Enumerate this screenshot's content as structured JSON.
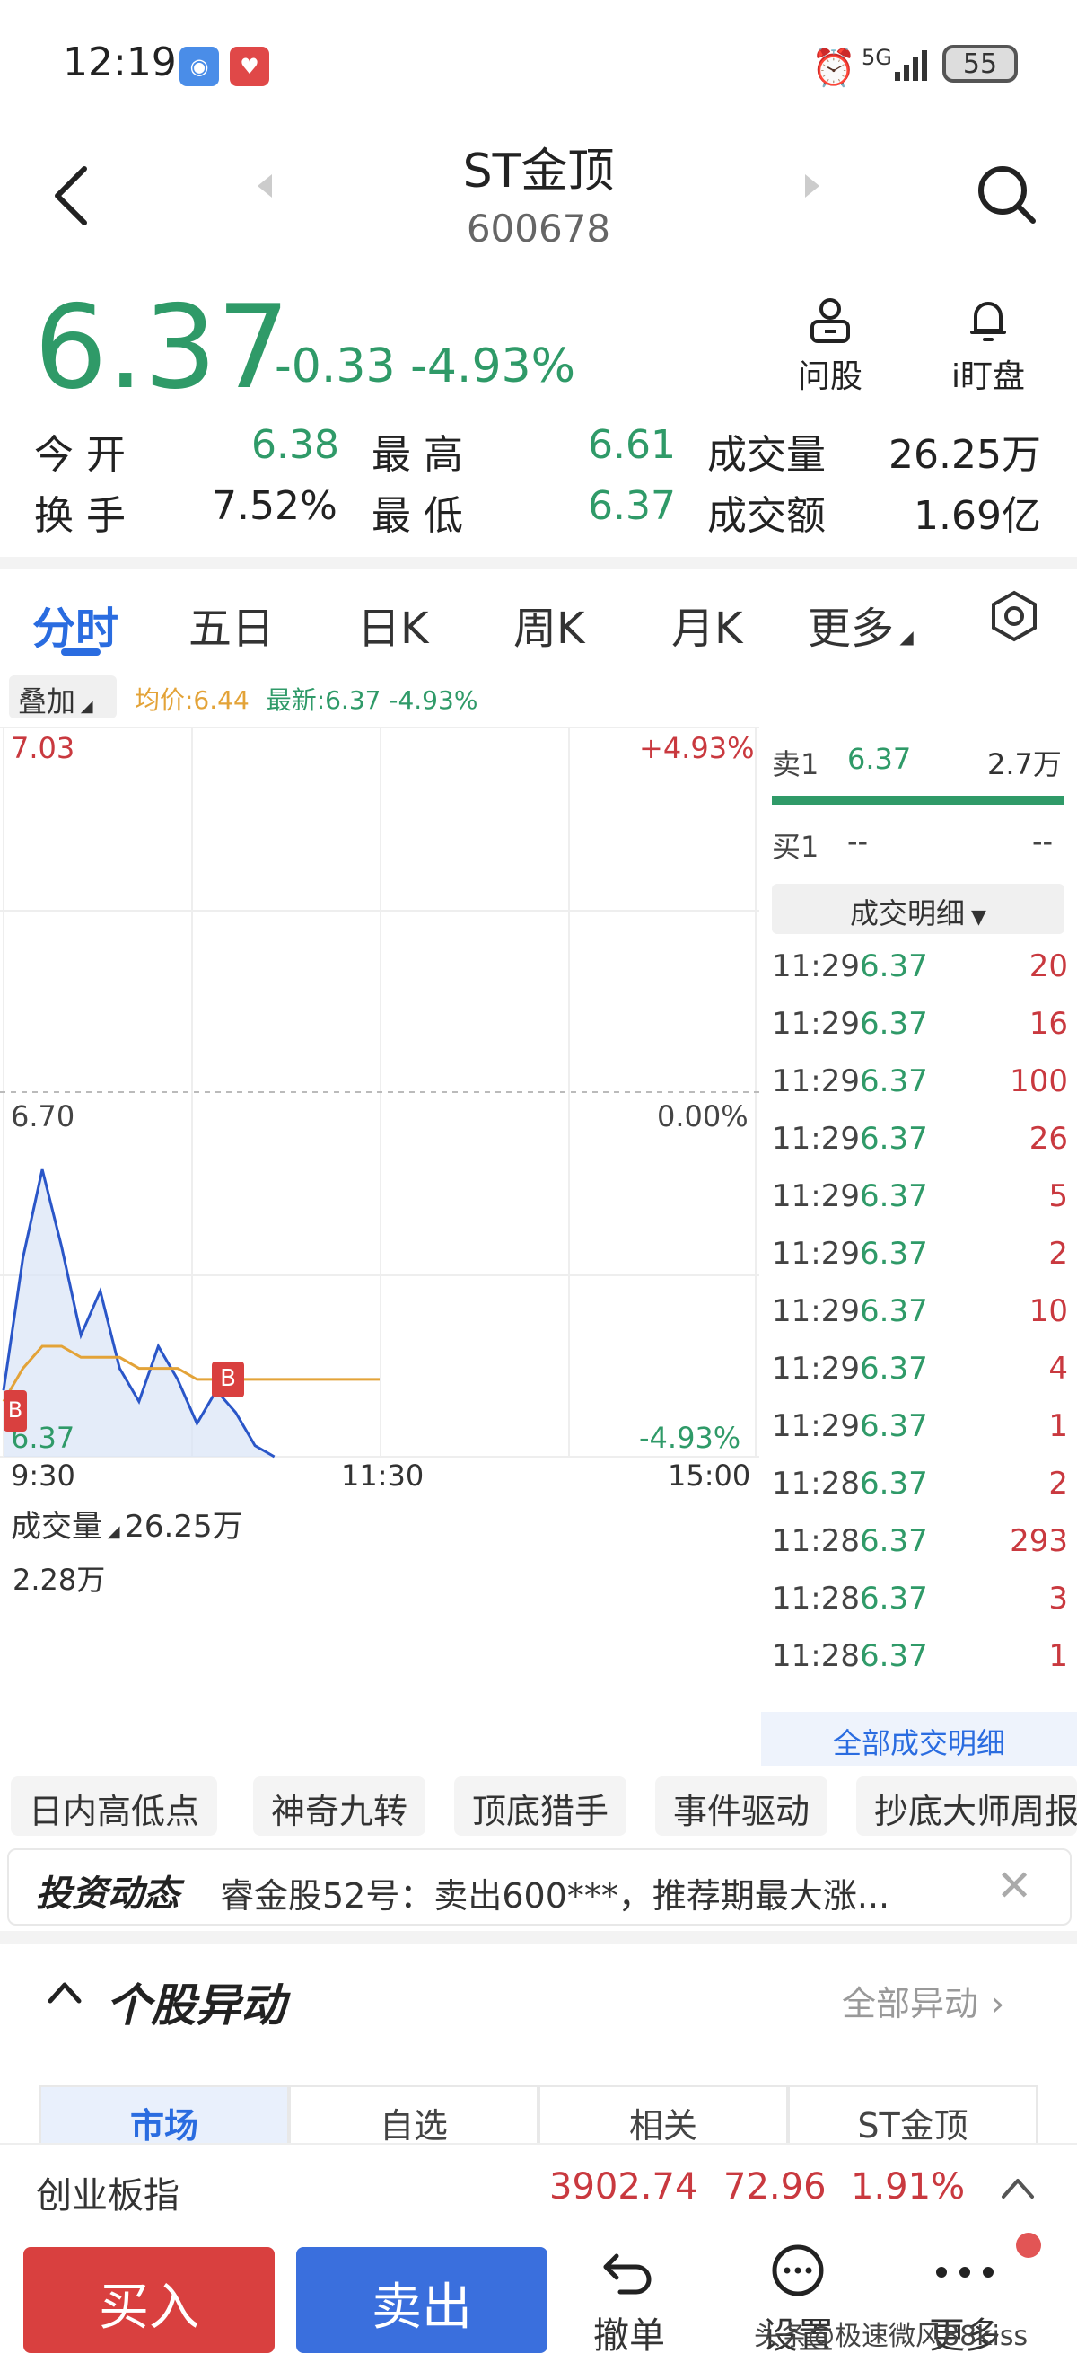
{
  "status_bar": {
    "time": "12:19",
    "network": "5G",
    "battery": "55"
  },
  "header": {
    "stock_name": "ST金顶",
    "stock_code": "600678"
  },
  "price": {
    "last": "6.37",
    "change": "-0.33",
    "change_pct": "-4.93%"
  },
  "actions": {
    "ask_label": "问股",
    "watch_label": "i盯盘"
  },
  "quote": {
    "open_label": "今 开",
    "open": "6.38",
    "high_label": "最 高",
    "high": "6.61",
    "volume_label": "成交量",
    "volume": "26.25万",
    "turnover_label": "换 手",
    "turnover": "7.52%",
    "low_label": "最 低",
    "low": "6.37",
    "amount_label": "成交额",
    "amount": "1.69亿"
  },
  "tabs": [
    "分时",
    "五日",
    "日K",
    "周K",
    "月K",
    "更多"
  ],
  "chart_toolbar": {
    "overlay": "叠加",
    "avg_price": "均价:6.44",
    "latest": "最新:6.37 -4.93%"
  },
  "chart_data": {
    "type": "line",
    "y_axis_left": [
      "7.03",
      "6.70",
      "6.37"
    ],
    "y_axis_right": [
      "+4.93%",
      "0.00%",
      "-4.93%"
    ],
    "x_ticks": [
      "9:30",
      "11:30",
      "15:00"
    ],
    "ylim": [
      6.37,
      7.03
    ],
    "series": [
      {
        "values": [
          6.43,
          6.55,
          6.63,
          6.56,
          6.48,
          6.52,
          6.45,
          6.42,
          6.47,
          6.44,
          6.4,
          6.43,
          6.41,
          6.38,
          6.37
        ]
      },
      {
        "values": [
          6.42,
          6.45,
          6.47,
          6.47,
          6.46,
          6.46,
          6.46,
          6.45,
          6.45,
          6.45,
          6.44,
          6.44,
          6.44,
          6.44,
          6.44
        ]
      }
    ],
    "volume": {
      "label": "成交量",
      "total": "26.25万",
      "max_label": "2.28万"
    }
  },
  "order_book": {
    "sell1_label": "卖1",
    "sell1_price": "6.37",
    "sell1_vol": "2.7万",
    "buy1_label": "买1",
    "buy1_price": "--",
    "buy1_vol": "--"
  },
  "trades": {
    "header": "成交明细",
    "rows": [
      {
        "t": "11:29",
        "p": "6.37",
        "v": "20"
      },
      {
        "t": "11:29",
        "p": "6.37",
        "v": "16"
      },
      {
        "t": "11:29",
        "p": "6.37",
        "v": "100"
      },
      {
        "t": "11:29",
        "p": "6.37",
        "v": "26"
      },
      {
        "t": "11:29",
        "p": "6.37",
        "v": "5"
      },
      {
        "t": "11:29",
        "p": "6.37",
        "v": "2"
      },
      {
        "t": "11:29",
        "p": "6.37",
        "v": "10"
      },
      {
        "t": "11:29",
        "p": "6.37",
        "v": "4"
      },
      {
        "t": "11:29",
        "p": "6.37",
        "v": "1"
      },
      {
        "t": "11:28",
        "p": "6.37",
        "v": "2"
      },
      {
        "t": "11:28",
        "p": "6.37",
        "v": "293"
      },
      {
        "t": "11:28",
        "p": "6.37",
        "v": "3"
      },
      {
        "t": "11:28",
        "p": "6.37",
        "v": "1"
      }
    ],
    "all_link": "全部成交明细"
  },
  "chips": [
    "日内高低点",
    "神奇九转",
    "顶底猎手",
    "事件驱动",
    "抄底大师周报"
  ],
  "news": {
    "title": "投资动态",
    "text": "睿金股52号：卖出600***，推荐期最大涨..."
  },
  "anomaly": {
    "title": "个股异动",
    "more": "全部异动",
    "segments": [
      "市场",
      "自选",
      "相关",
      "ST金顶"
    ]
  },
  "index_bar": {
    "name": "创业板指",
    "value": "3902.74",
    "change": "72.96",
    "pct": "1.91%"
  },
  "bottom": {
    "buy": "买入",
    "sell": "卖出",
    "cancel": "撤单",
    "settings": "设置",
    "more": "更多"
  },
  "watermark": "头条@极速微风88kiss",
  "colors": {
    "down": "#2f9a68",
    "up": "#c9393f",
    "accent": "#2a6ce0",
    "avg_line": "#e3a338"
  }
}
